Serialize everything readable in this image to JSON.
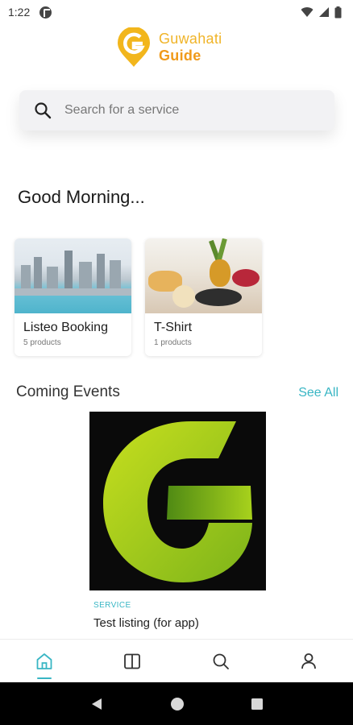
{
  "status_bar": {
    "time": "1:22"
  },
  "header": {
    "brand_line1": "Guwahati",
    "brand_line2": "Guide"
  },
  "search": {
    "placeholder": "Search for a service"
  },
  "greeting": "Good Morning...",
  "categories": [
    {
      "title": "Listeo Booking",
      "subtitle": "5 products"
    },
    {
      "title": "T-Shirt",
      "subtitle": "1 products"
    }
  ],
  "events": {
    "heading": "Coming Events",
    "see_all": "See All",
    "items": [
      {
        "category": "SERVICE",
        "title": "Test listing (for app)"
      }
    ]
  },
  "colors": {
    "accent": "#39b6c4",
    "logo_yellow": "#f0b428",
    "logo_orange": "#f09a1a",
    "event_green": "#9ccc1a"
  },
  "bottom_nav": [
    {
      "name": "home",
      "icon": "home-icon",
      "active": true
    },
    {
      "name": "listings",
      "icon": "book-icon",
      "active": false
    },
    {
      "name": "search",
      "icon": "search-icon",
      "active": false
    },
    {
      "name": "profile",
      "icon": "user-icon",
      "active": false
    }
  ]
}
